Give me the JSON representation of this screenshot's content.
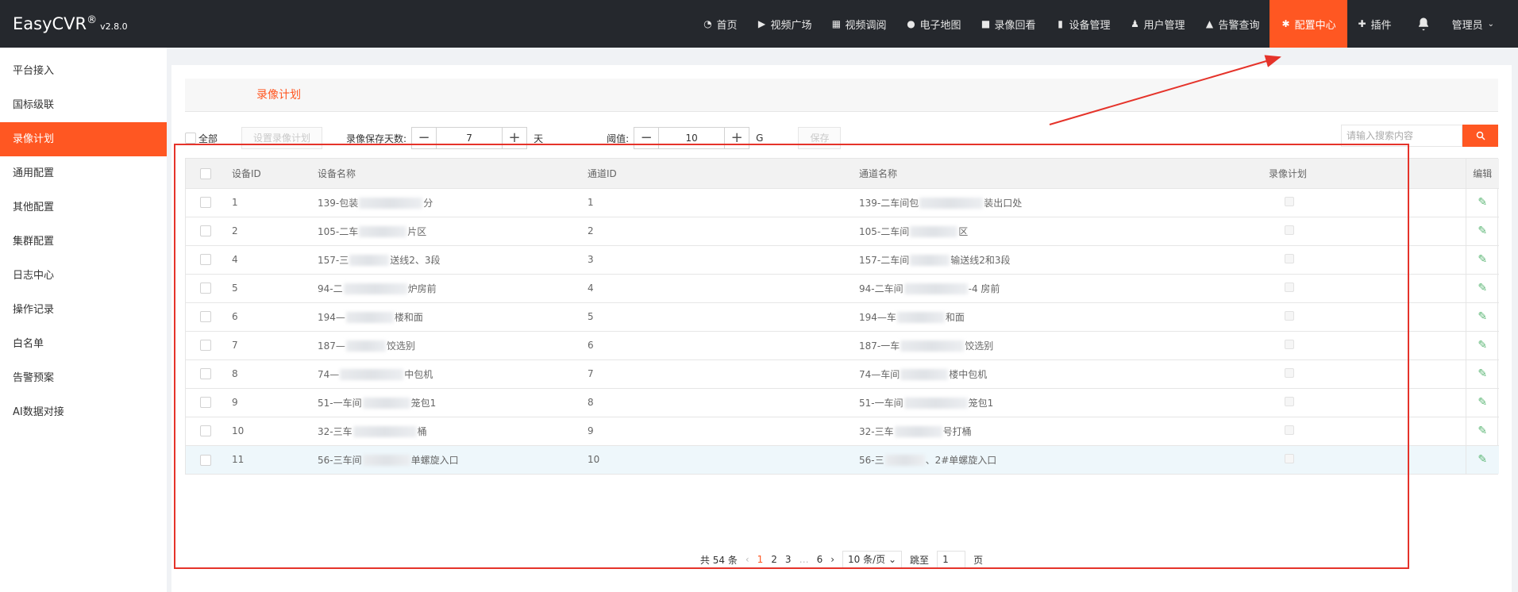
{
  "header": {
    "brand": "EasyCVR",
    "reg": "®",
    "version": "v2.8.0",
    "nav": [
      {
        "icon": "dashboard-icon",
        "glyph": "◔",
        "label": "首页"
      },
      {
        "icon": "play-icon",
        "glyph": "▶",
        "label": "视频广场"
      },
      {
        "icon": "grid-icon",
        "glyph": "▦",
        "label": "视频调阅"
      },
      {
        "icon": "map-pin-icon",
        "glyph": "●",
        "label": "电子地图"
      },
      {
        "icon": "video-camera-icon",
        "glyph": "■",
        "label": "录像回看"
      },
      {
        "icon": "bars-icon",
        "glyph": "▮",
        "label": "设备管理"
      },
      {
        "icon": "user-icon",
        "glyph": "♟",
        "label": "用户管理"
      },
      {
        "icon": "alarm-icon",
        "glyph": "▲",
        "label": "告警查询"
      },
      {
        "icon": "gear-icon",
        "glyph": "✱",
        "label": "配置中心"
      },
      {
        "icon": "puzzle-icon",
        "glyph": "✚",
        "label": "插件"
      }
    ],
    "user": "管理员"
  },
  "sidebar": {
    "items": [
      "平台接入",
      "国标级联",
      "录像计划",
      "通用配置",
      "其他配置",
      "集群配置",
      "日志中心",
      "操作记录",
      "白名单",
      "告警预案",
      "AI数据对接"
    ]
  },
  "main": {
    "tab_title": "录像计划",
    "controls": {
      "select_all": "全部",
      "set_plan_button": "设置录像计划",
      "keep_days_label": "录像保存天数:",
      "keep_days_value": "7",
      "days_unit": "天",
      "threshold_label": "阈值:",
      "threshold_value": "10",
      "threshold_unit": "G",
      "save_button": "保存",
      "search_placeholder": "请输入搜索内容"
    },
    "table": {
      "columns": [
        "设备ID",
        "设备名称",
        "通道ID",
        "通道名称",
        "录像计划",
        "编辑"
      ],
      "rows": [
        {
          "device_id": "1",
          "device_a": "139-包装",
          "device_b": "分",
          "channel_id": "1",
          "channel_a": "139-二车间包",
          "channel_b": "装出口处"
        },
        {
          "device_id": "2",
          "device_a": "105-二车",
          "device_b": "片区",
          "channel_id": "2",
          "channel_a": "105-二车间",
          "channel_b": "区"
        },
        {
          "device_id": "4",
          "device_a": "157-三",
          "device_b": "送线2、3段",
          "channel_id": "3",
          "channel_a": "157-二车间",
          "channel_b": "输送线2和3段"
        },
        {
          "device_id": "5",
          "device_a": "94-二",
          "device_b": "炉房前",
          "channel_id": "4",
          "channel_a": "94-二车间",
          "channel_b": "-4 房前"
        },
        {
          "device_id": "6",
          "device_a": "194—",
          "device_b": "楼和面",
          "channel_id": "5",
          "channel_a": "194—车",
          "channel_b": "和面"
        },
        {
          "device_id": "7",
          "device_a": "187—",
          "device_b": "饺选别",
          "channel_id": "6",
          "channel_a": "187-一车",
          "channel_b": "饺选别"
        },
        {
          "device_id": "8",
          "device_a": "74—",
          "device_b": "中包机",
          "channel_id": "7",
          "channel_a": "74—车间",
          "channel_b": "楼中包机"
        },
        {
          "device_id": "9",
          "device_a": "51-一车间",
          "device_b": "笼包1",
          "channel_id": "8",
          "channel_a": "51-一车间",
          "channel_b": "笼包1"
        },
        {
          "device_id": "10",
          "device_a": "32-三车",
          "device_b": "桶",
          "channel_id": "9",
          "channel_a": "32-三车",
          "channel_b": "号打桶"
        },
        {
          "device_id": "11",
          "device_a": "56-三车间",
          "device_b": "单螺旋入口",
          "channel_id": "10",
          "channel_a": "56-三",
          "channel_b": "、2#单螺旋入口"
        }
      ]
    },
    "pager": {
      "total": "共 54 条",
      "prev": "‹",
      "pages": [
        "1",
        "2",
        "3",
        "…",
        "6"
      ],
      "next": "›",
      "limit": "10 条/页",
      "jump_label": "跳至",
      "jump_value": "1",
      "page_unit": "页"
    }
  },
  "colors": {
    "accent": "#ff5722",
    "header_bg": "#25282d",
    "edit_icon": "#5fb878",
    "annotation": "#e5332a"
  }
}
